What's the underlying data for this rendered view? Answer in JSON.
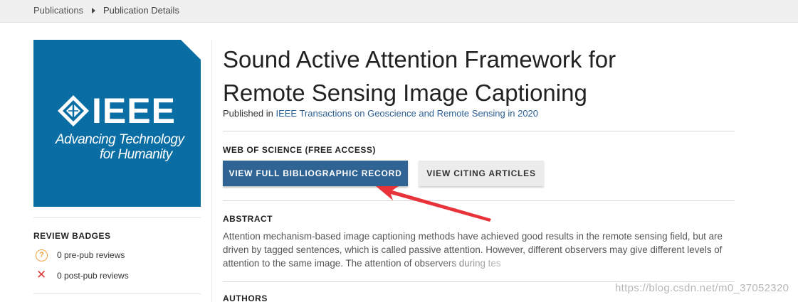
{
  "breadcrumb": {
    "items": [
      "Publications",
      "Publication Details"
    ]
  },
  "logo": {
    "wordmark": "IEEE",
    "tagline_1": "Advancing Technology",
    "tagline_2": "for Humanity",
    "background_color": "#0a6ea4"
  },
  "review_badges": {
    "heading": "REVIEW BADGES",
    "items": [
      {
        "icon": "question-circle-icon",
        "text": "0 pre-pub reviews",
        "color": "#f0a040"
      },
      {
        "icon": "x-icon",
        "text": "0 post-pub reviews",
        "color": "#e04040"
      }
    ]
  },
  "publication": {
    "title": "Sound Active Attention Framework for Remote Sensing Image Captioning",
    "published_prefix": "Published in",
    "journal_link": "IEEE Transactions on Geoscience and Remote Sensing in 2020"
  },
  "web_of_science": {
    "heading": "WEB OF SCIENCE (FREE ACCESS)",
    "primary_button": "VIEW FULL BIBLIOGRAPHIC RECORD",
    "secondary_button": "VIEW CITING ARTICLES"
  },
  "abstract": {
    "heading": "ABSTRACT",
    "text": "Attention mechanism-based image captioning methods have achieved good results in the remote sensing field, but are driven by tagged sentences, which is called passive attention. However, different observers may give different levels of attention to the same image. The attention of observers during tes"
  },
  "authors": {
    "heading": "AUTHORS"
  },
  "annotation": {
    "arrow_color": "#e8333a"
  },
  "watermark": {
    "text": "https://blog.csdn.net/m0_37052320"
  },
  "colors": {
    "primary_button": "#2f6494",
    "link": "#2a5f94"
  }
}
